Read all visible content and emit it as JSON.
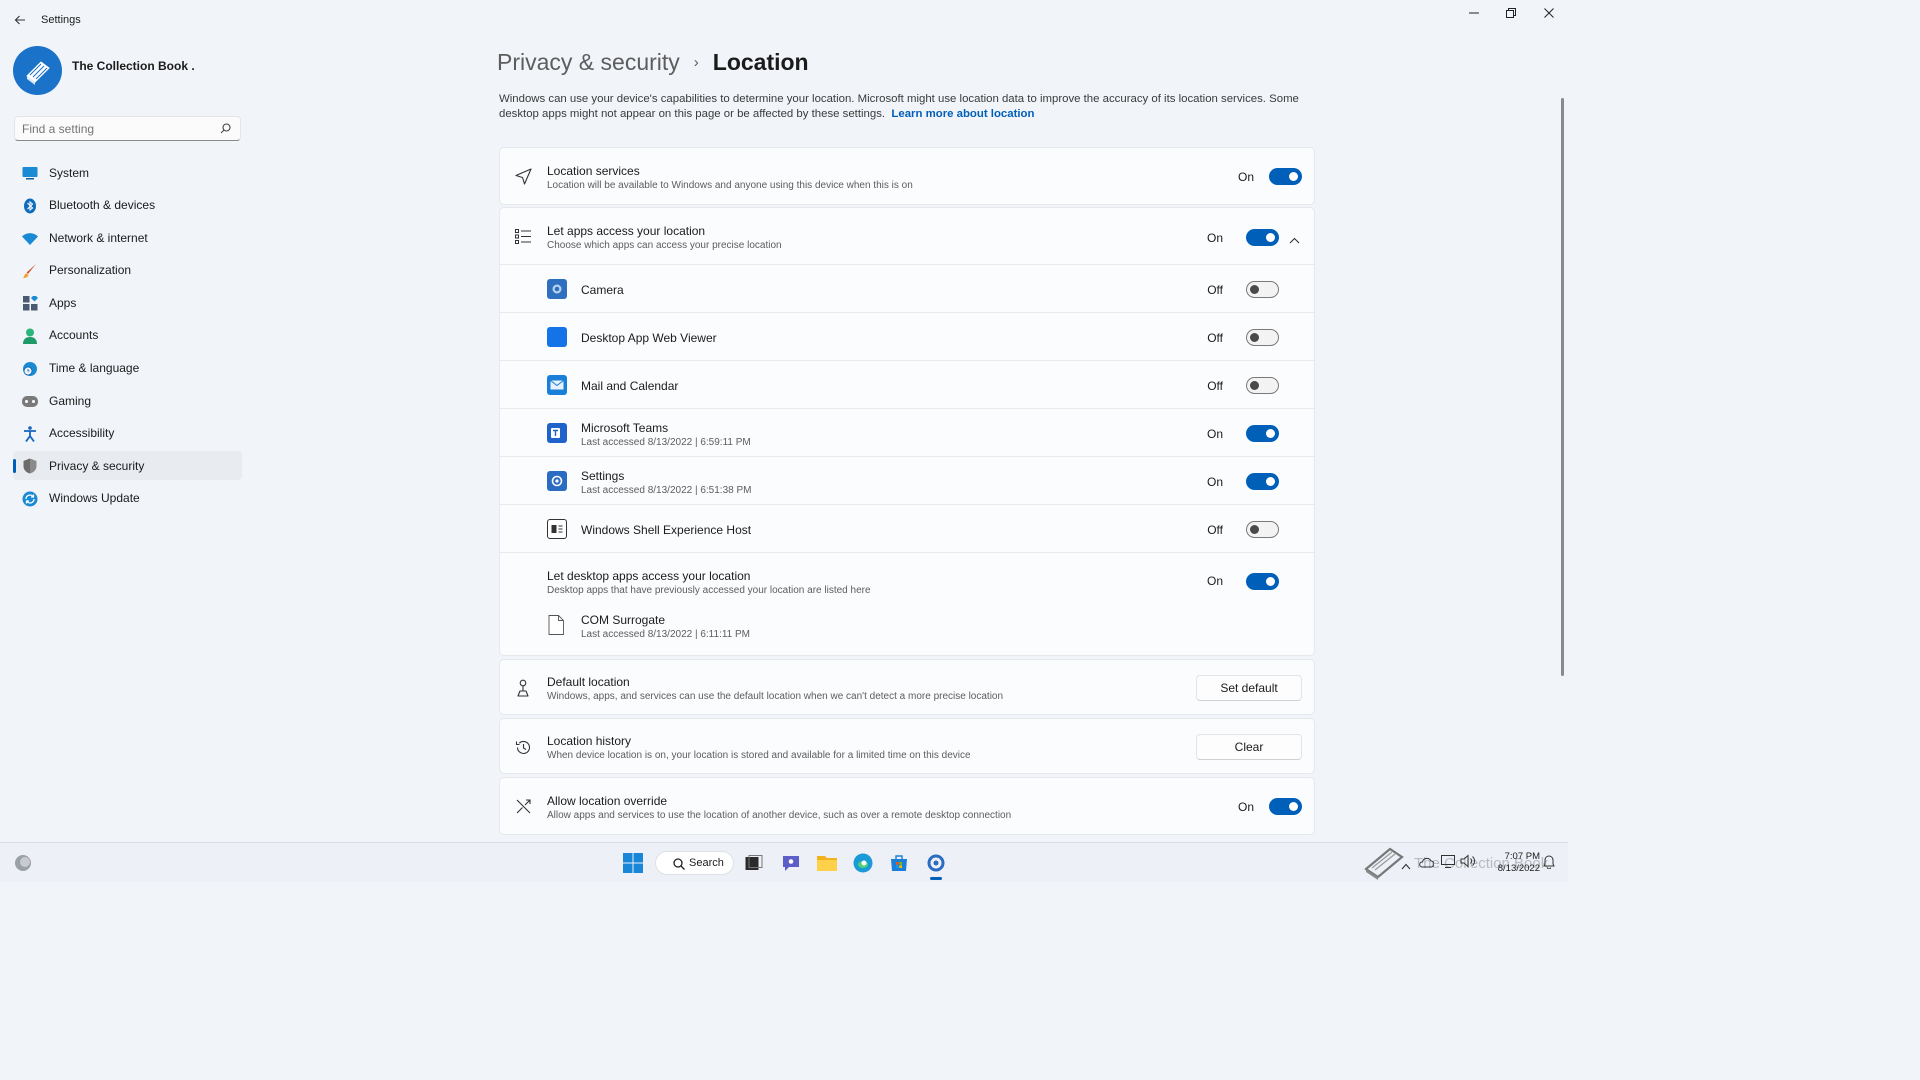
{
  "window": {
    "title": "Settings",
    "controls": [
      "minimize",
      "restore",
      "close"
    ]
  },
  "profile": {
    "name": "The Collection Book ."
  },
  "search": {
    "placeholder": "Find a setting"
  },
  "sidebar": {
    "items": [
      {
        "label": "System",
        "icon": "monitor-icon",
        "color": "#1a8ad4"
      },
      {
        "label": "Bluetooth & devices",
        "icon": "bluetooth-icon",
        "color": "#0f6cbd"
      },
      {
        "label": "Network & internet",
        "icon": "wifi-icon",
        "color": "#1a8ad4"
      },
      {
        "label": "Personalization",
        "icon": "brush-icon",
        "color": "#d65a31"
      },
      {
        "label": "Apps",
        "icon": "apps-icon",
        "color": "#4a5a70"
      },
      {
        "label": "Accounts",
        "icon": "person-icon",
        "color": "#2bb57a"
      },
      {
        "label": "Time & language",
        "icon": "globe-clock-icon",
        "color": "#1a8ad4"
      },
      {
        "label": "Gaming",
        "icon": "gamepad-icon",
        "color": "#6b6b6b"
      },
      {
        "label": "Accessibility",
        "icon": "accessibility-icon",
        "color": "#1565c0"
      },
      {
        "label": "Privacy & security",
        "icon": "shield-icon",
        "color": "#6b6b6b",
        "active": true
      },
      {
        "label": "Windows Update",
        "icon": "update-icon",
        "color": "#1a8ad4"
      }
    ]
  },
  "breadcrumb": {
    "parent": "Privacy & security",
    "separator": "›",
    "current": "Location"
  },
  "intro": {
    "text": "Windows can use your device's capabilities to determine your location. Microsoft might use location data to improve the accuracy of its location services. Some desktop apps might not appear on this page or be affected by these settings.",
    "link": "Learn more about location"
  },
  "location_services": {
    "title": "Location services",
    "subtitle": "Location will be available to Windows and anyone using this device when this is on",
    "state": "On"
  },
  "app_access": {
    "title": "Let apps access your location",
    "subtitle": "Choose which apps can access your precise location",
    "state": "On",
    "apps": [
      {
        "name": "Camera",
        "last": "",
        "state": "Off",
        "icon": "camera-icon"
      },
      {
        "name": "Desktop App Web Viewer",
        "last": "",
        "state": "Off",
        "icon": "web-viewer-icon"
      },
      {
        "name": "Mail and Calendar",
        "last": "",
        "state": "Off",
        "icon": "mail-icon"
      },
      {
        "name": "Microsoft Teams",
        "last": "Last accessed 8/13/2022  |  6:59:11 PM",
        "state": "On",
        "icon": "teams-icon"
      },
      {
        "name": "Settings",
        "last": "Last accessed 8/13/2022  |  6:51:38 PM",
        "state": "On",
        "icon": "settings-gear-icon"
      },
      {
        "name": "Windows Shell Experience Host",
        "last": "",
        "state": "Off",
        "icon": "shell-host-icon"
      }
    ],
    "desktop": {
      "title": "Let desktop apps access your location",
      "subtitle": "Desktop apps that have previously accessed your location are listed here",
      "state": "On",
      "apps": [
        {
          "name": "COM Surrogate",
          "last": "Last accessed 8/13/2022  |  6:11:11 PM",
          "icon": "file-icon"
        }
      ]
    }
  },
  "default_location": {
    "title": "Default location",
    "subtitle": "Windows, apps, and services can use the default location when we can't detect a more precise location",
    "button": "Set default"
  },
  "location_history": {
    "title": "Location history",
    "subtitle": "When device location is on, your location is stored and available for a limited time on this device",
    "button": "Clear"
  },
  "location_override": {
    "title": "Allow location override",
    "subtitle": "Allow apps and services to use the location of another device, such as over a remote desktop connection",
    "state": "On"
  },
  "taskbar": {
    "search_label": "Search",
    "time": "7:07 PM",
    "date": "8/13/2022",
    "watermark": "The Collection Book"
  },
  "colors": {
    "accent": "#005fb8",
    "background": "#f1f4f9",
    "card": "#fbfcfd"
  }
}
